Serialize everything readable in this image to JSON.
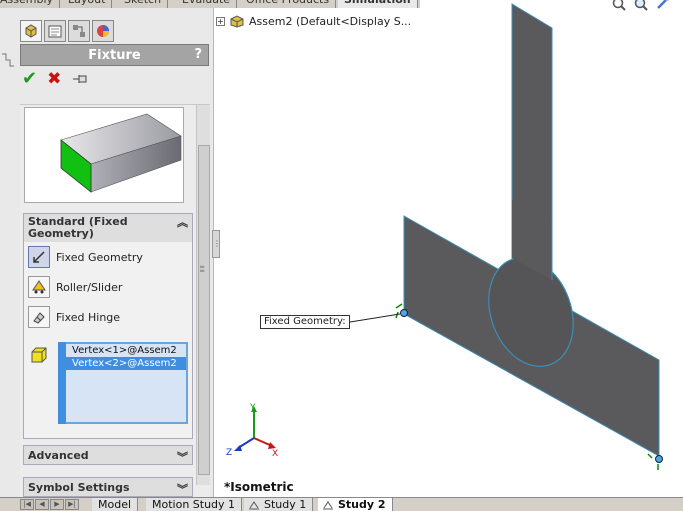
{
  "top_tabs": [
    "Assembly",
    "Layout",
    "Sketch",
    "Evaluate",
    "Office Products",
    "Simulation"
  ],
  "panel": {
    "title": "Fixture",
    "help": "?",
    "groups": {
      "standard": {
        "title": "Standard (Fixed Geometry)",
        "types": [
          "Fixed Geometry",
          "Roller/Slider",
          "Fixed Hinge"
        ],
        "selections": [
          "Vertex<1>@Assem2",
          "Vertex<2>@Assem2"
        ]
      },
      "advanced": "Advanced",
      "symbol_settings": "Symbol Settings"
    }
  },
  "tree": {
    "root": "Assem2  (Default<Display S..."
  },
  "graphics": {
    "callout": "Fixed Geometry:",
    "view_label": "*Isometric",
    "triad": {
      "x": "X",
      "y": "Y",
      "z": "Z"
    }
  },
  "bottom_tabs": [
    "Model",
    "Motion Study 1",
    "Study 1",
    "Study 2"
  ],
  "colors": {
    "part_fill": "#5a5a5c",
    "edge": "#3a8fb8",
    "selected_face": "#00cc00",
    "accent": "#3f8ee0"
  }
}
